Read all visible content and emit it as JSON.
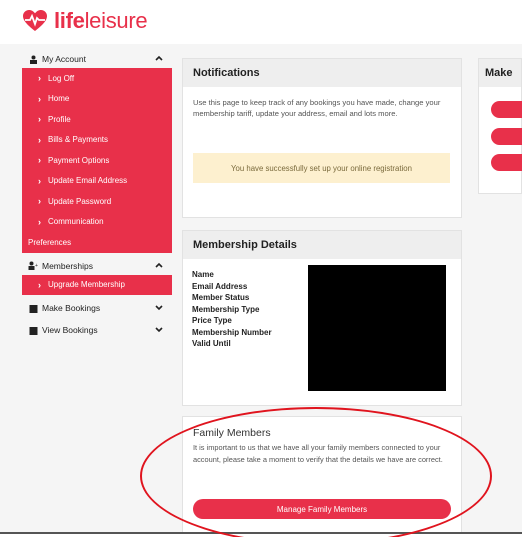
{
  "brand": {
    "name_bold": "life",
    "name_light": "leisure",
    "color": "#e8304a"
  },
  "sidebar": {
    "my_account": "My Account",
    "account_items": [
      {
        "label": "Log Off"
      },
      {
        "label": "Home"
      },
      {
        "label": "Profile"
      },
      {
        "label": "Bills & Payments"
      },
      {
        "label": "Payment Options"
      },
      {
        "label": "Update Email Address"
      },
      {
        "label": "Update Password"
      },
      {
        "label": "Communication"
      }
    ],
    "preferences": "Preferences",
    "memberships": "Memberships",
    "upgrade": "Upgrade Membership",
    "make_bookings": "Make Bookings",
    "view_bookings": "View Bookings"
  },
  "notifications": {
    "title": "Notifications",
    "text": "Use this page to keep track of any bookings you have made, change your membership tariff, update your address, email and lots more.",
    "success": "You have successfully set up your online registration"
  },
  "make": {
    "title": "Make"
  },
  "membership": {
    "title": "Membership Details",
    "labels": [
      "Name",
      "Email Address",
      "Member Status",
      "Membership Type",
      "Price Type",
      "Membership Number",
      "Valid Until"
    ]
  },
  "family": {
    "title": "Family Members",
    "text": "It is important to us that we have all your family members connected to your account, please take a moment to verify that the details we have are correct.",
    "button": "Manage Family Members"
  }
}
